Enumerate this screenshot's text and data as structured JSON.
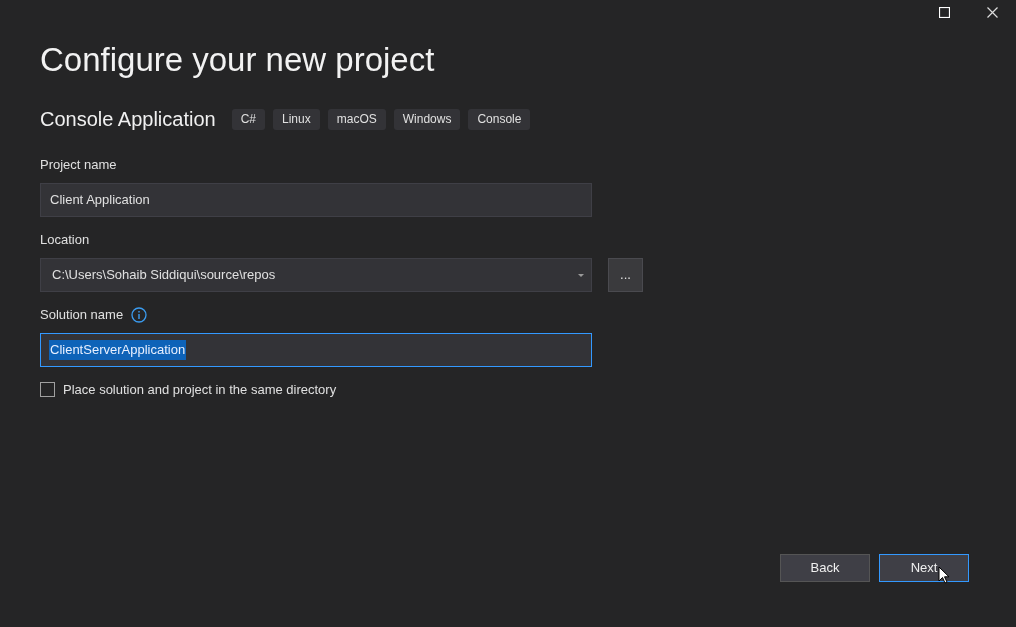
{
  "title": "Configure your new project",
  "template": {
    "name": "Console Application",
    "tags": [
      "C#",
      "Linux",
      "macOS",
      "Windows",
      "Console"
    ]
  },
  "fields": [
    {
      "kind": "text",
      "label": "Project name",
      "value": "Client Application",
      "focused": false
    },
    {
      "kind": "dropdown",
      "label": "Location",
      "value": "C:\\Users\\Sohaib Siddiqui\\source\\repos",
      "browse": "...",
      "focused": false
    },
    {
      "kind": "text",
      "label": "Solution name",
      "value": "ClientServerApplication",
      "focused": true,
      "info": true
    }
  ],
  "checkbox": {
    "label": "Place solution and project in the same directory",
    "checked": false
  },
  "buttons": [
    {
      "label": "Back",
      "focused": false
    },
    {
      "label": "Next",
      "focused": true
    }
  ]
}
